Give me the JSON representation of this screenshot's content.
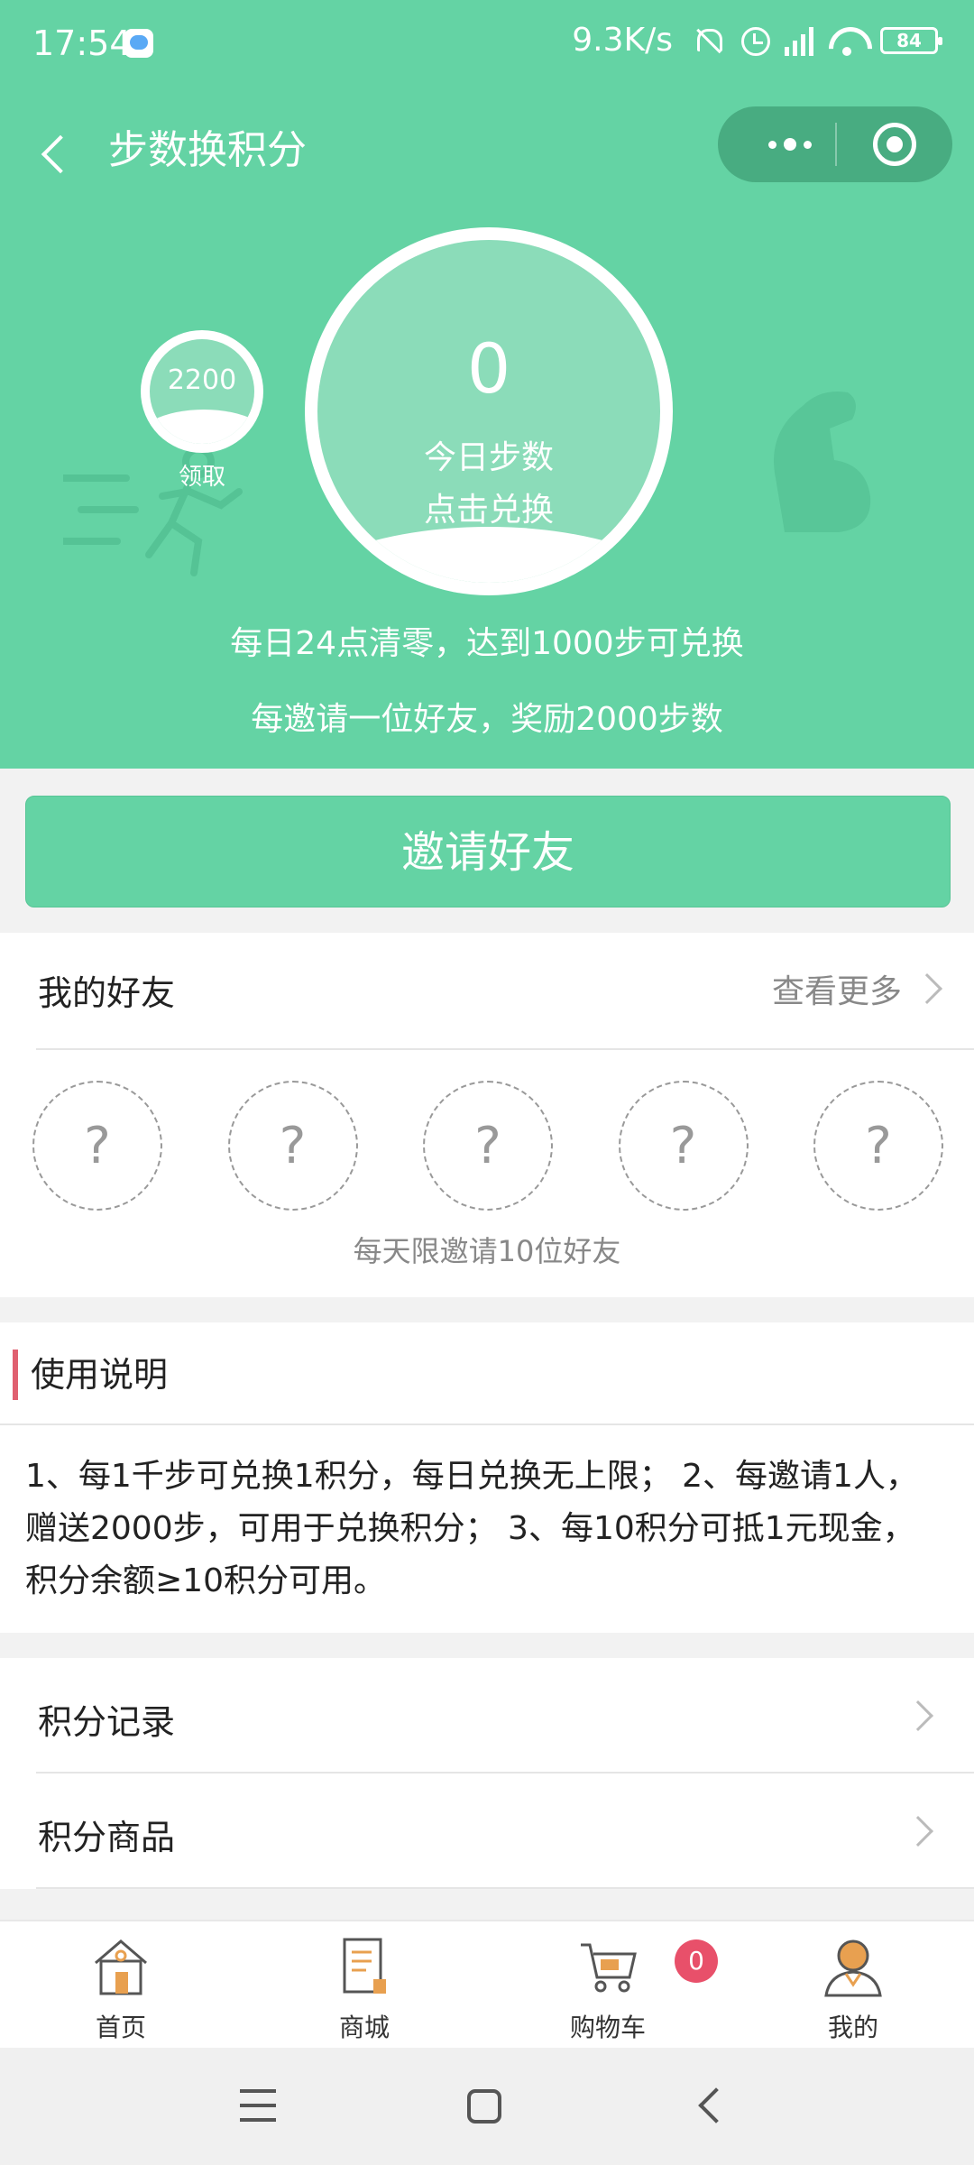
{
  "status_bar": {
    "time": "17:54",
    "net_speed": "9.3K/s",
    "battery": "84",
    "icons": [
      "app-notification-icon",
      "bell-off-icon",
      "alarm-icon",
      "signal-icon",
      "wifi-icon",
      "battery-icon"
    ]
  },
  "nav": {
    "title": "步数换积分"
  },
  "header": {
    "badge_value": "2200",
    "badge_label": "领取",
    "today_steps": "0",
    "today_label": "今日步数",
    "dial_action": "点击兑换",
    "rule_line_1": "每日24点清零，达到1000步可兑换",
    "rule_line_2": "每邀请一位好友，奖励2000步数"
  },
  "invite": {
    "button_label": "邀请好友"
  },
  "friends": {
    "title": "我的好友",
    "more_label": "查看更多",
    "slots": [
      "?",
      "?",
      "?",
      "?",
      "?"
    ],
    "limit_text": "每天限邀请10位好友"
  },
  "usage": {
    "title": "使用说明",
    "body": "1、每1千步可兑换1积分，每日兑换无上限； 2、每邀请1人，赠送2000步，可用于兑换积分； 3、每10积分可抵1元现金，积分余额≥10积分可用。"
  },
  "menu": {
    "items": [
      {
        "label": "积分记录"
      },
      {
        "label": "积分商品"
      }
    ]
  },
  "tab_bar": {
    "items": [
      {
        "label": "首页",
        "icon": "home-icon"
      },
      {
        "label": "商城",
        "icon": "mall-icon"
      },
      {
        "label": "购物车",
        "icon": "cart-icon"
      },
      {
        "label": "我的",
        "icon": "profile-icon"
      }
    ],
    "cart_badge": "0"
  },
  "colors": {
    "primary": "#64d3a4",
    "badge": "#e8506a",
    "accent_bar": "#e06070",
    "tab_icon": "#e8a050"
  }
}
